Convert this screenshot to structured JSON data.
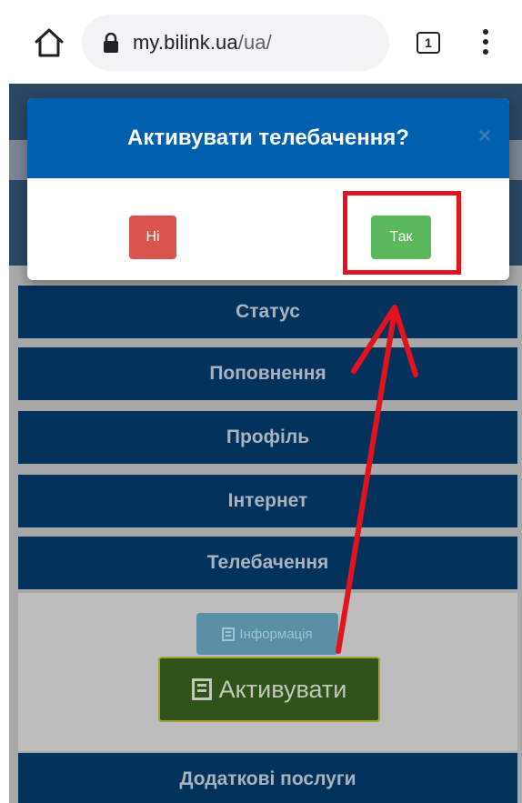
{
  "browser": {
    "url_domain": "my.bilink.ua",
    "url_path": "/ua/",
    "tab_count": "1",
    "icons": [
      "home-icon",
      "lock-icon",
      "tab-switcher-icon",
      "more-vert-icon"
    ]
  },
  "modal": {
    "title": "Активувати телебачення?",
    "close_label": "×",
    "no_label": "Ні",
    "yes_label": "Так"
  },
  "menu": {
    "items": [
      {
        "label": "Статус"
      },
      {
        "label": "Поповнення"
      },
      {
        "label": "Профіль"
      },
      {
        "label": "Інтернет"
      },
      {
        "label": "Телебачення"
      },
      {
        "label": "Додаткові послуги"
      }
    ]
  },
  "tv_panel": {
    "info_label": "Інформація",
    "activate_label": "Активувати"
  },
  "colors": {
    "modal_header": "#0060b0",
    "button_no": "#d9534f",
    "button_yes": "#5cb85c",
    "menu_item": "#03325d",
    "annotation": "#e3131e"
  }
}
